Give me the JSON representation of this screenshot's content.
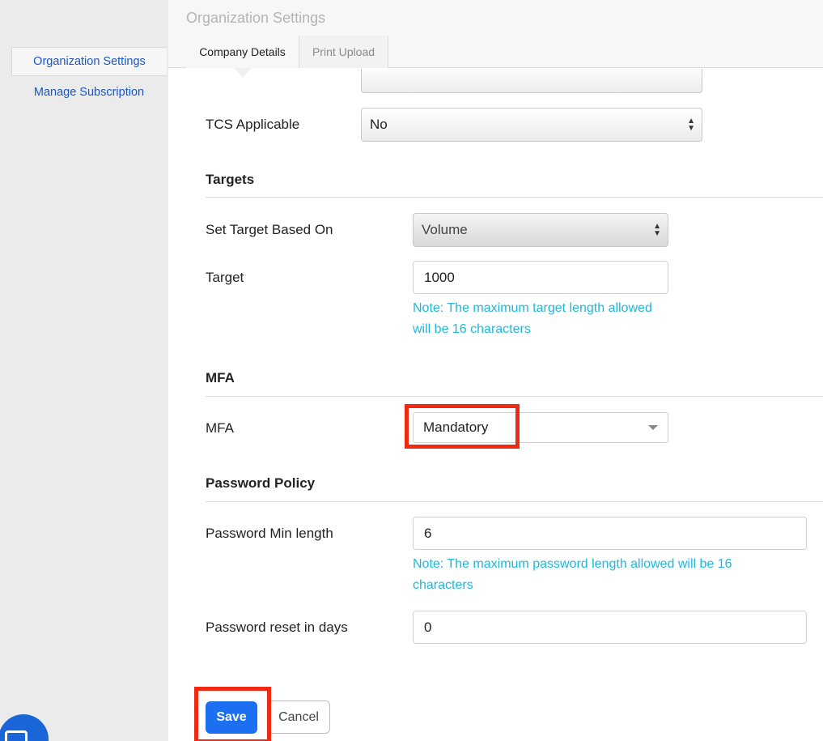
{
  "sidebar": {
    "items": [
      {
        "label": "Organization Settings",
        "active": true
      },
      {
        "label": "Manage Subscription",
        "active": false
      }
    ]
  },
  "header": {
    "title": "Organization Settings",
    "tabs": [
      {
        "label": "Company Details",
        "selected": true
      },
      {
        "label": "Print Upload",
        "selected": false
      }
    ]
  },
  "form": {
    "tcs": {
      "label": "TCS Applicable",
      "value": "No"
    },
    "targets": {
      "heading": "Targets",
      "based_on": {
        "label": "Set Target Based On",
        "value": "Volume"
      },
      "target": {
        "label": "Target",
        "value": "1000",
        "note": "Note: The maximum target length allowed will be 16 characters"
      }
    },
    "mfa": {
      "heading": "MFA",
      "field": {
        "label": "MFA",
        "value": "Mandatory"
      }
    },
    "password_policy": {
      "heading": "Password Policy",
      "min_length": {
        "label": "Password Min length",
        "value": "6",
        "note": "Note: The maximum password length allowed will be 16 characters"
      },
      "reset_days": {
        "label": "Password reset in days",
        "value": "0"
      }
    }
  },
  "actions": {
    "save": "Save",
    "cancel": "Cancel"
  },
  "colors": {
    "accent": "#1d6ff2",
    "note": "#1fb8da",
    "highlight": "#f02a12",
    "link": "#1a56c4"
  },
  "icons": {
    "select_updown": "updown-arrows-icon",
    "dropdown": "chevron-down-icon",
    "chat": "chat-icon"
  }
}
